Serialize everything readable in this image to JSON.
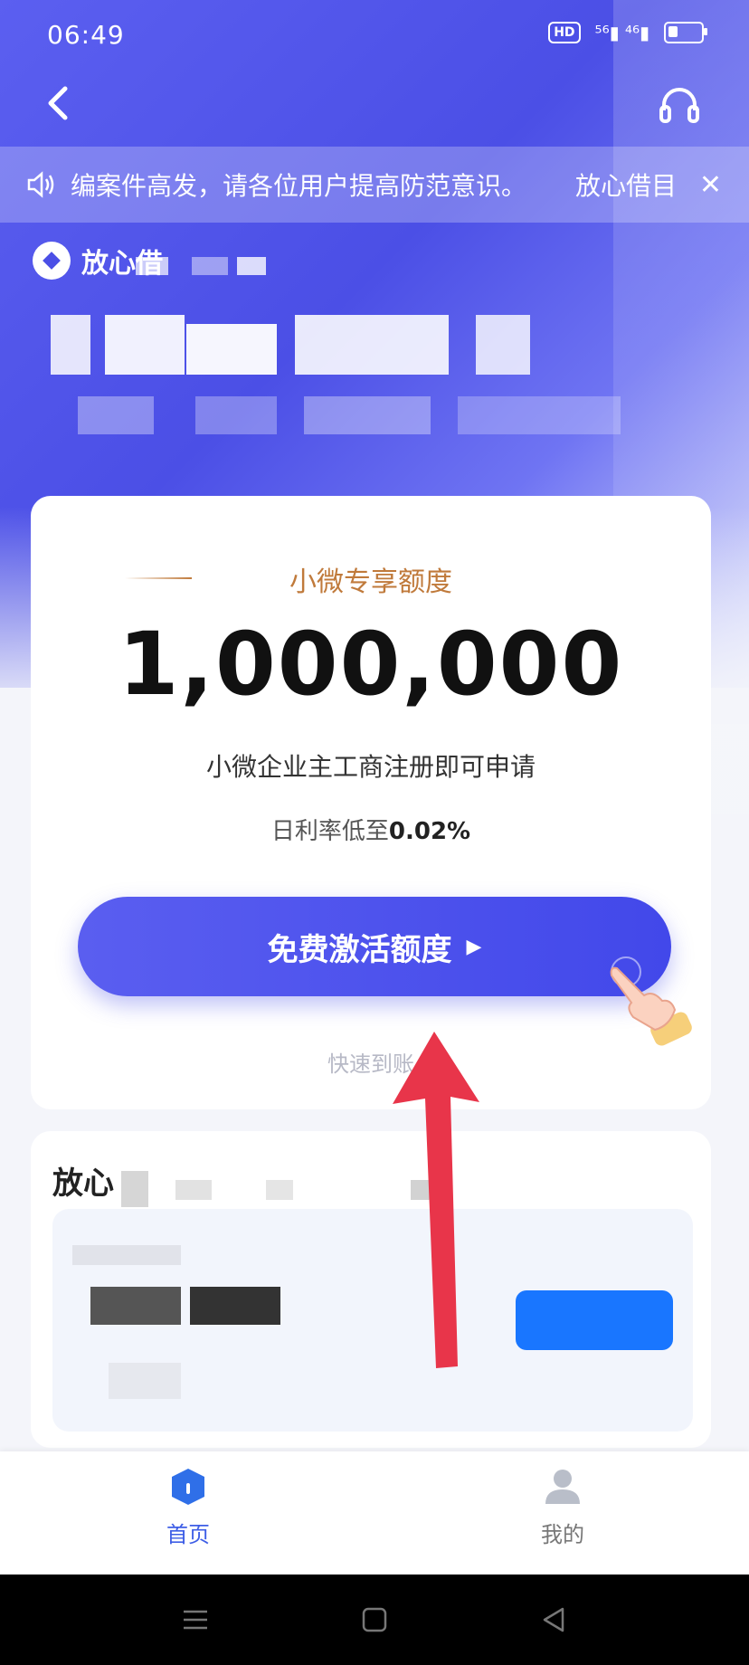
{
  "status": {
    "time": "06:49",
    "hd": "HD",
    "signal": "⁵⁶▮ ⁴⁶▮"
  },
  "notice": {
    "message": "编案件高发，请各位用户提高防范意识。",
    "brand": "放心借目",
    "close_symbol": "✕"
  },
  "brand": {
    "name": "放心借"
  },
  "card": {
    "subtitle": "小微专享额度",
    "amount": "1,000,000",
    "line1": "小微企业主工商注册即可申请",
    "rate_prefix": "日利率低至",
    "rate_value": "0.02%",
    "cta": "免费激活额度",
    "cta_arrow": "▶",
    "bottom_note": "快速到账"
  },
  "second_card": {
    "title": "放心"
  },
  "tabs": [
    {
      "label": "首页",
      "active": true
    },
    {
      "label": "我的",
      "active": false
    }
  ],
  "colors": {
    "primary": "#4b4fe6",
    "accent_gold": "#c07a3b",
    "tab_active": "#3e5ee6",
    "red_arrow": "#e8354a"
  }
}
